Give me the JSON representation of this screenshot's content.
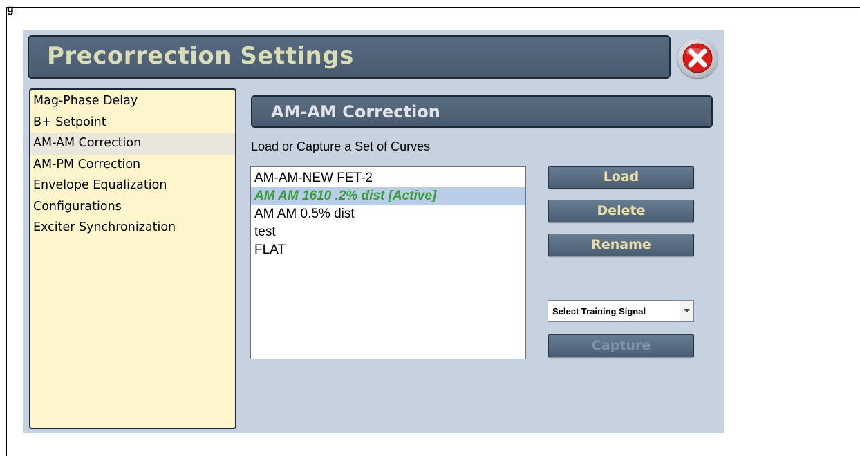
{
  "document": {
    "heading_fragment": "g"
  },
  "title_bar": {
    "title": "Precorrection Settings"
  },
  "close_button": {
    "icon": "close-icon",
    "color": "#e02020"
  },
  "nav": {
    "items": [
      {
        "label": "Mag-Phase Delay"
      },
      {
        "label": "B+ Setpoint"
      },
      {
        "label": "AM-AM Correction"
      },
      {
        "label": "AM-PM Correction"
      },
      {
        "label": "Envelope Equalization"
      },
      {
        "label": "Configurations"
      },
      {
        "label": "Exciter Synchronization"
      }
    ],
    "selected": "AM-AM Correction"
  },
  "section": {
    "title": "AM-AM Correction",
    "instructions": "Load or Capture a Set of Curves"
  },
  "curves": {
    "items": [
      {
        "label": "AM-AM-NEW FET-2"
      },
      {
        "label": "AM AM 1610 .2% dist [Active]"
      },
      {
        "label": "AM AM 0.5% dist"
      },
      {
        "label": "test"
      },
      {
        "label": "FLAT"
      }
    ],
    "active": "AM AM 1610 .2% dist [Active]"
  },
  "actions": {
    "load_label": "Load",
    "delete_label": "Delete",
    "rename_label": "Rename",
    "capture_label": "Capture",
    "capture_enabled": false
  },
  "training_signal": {
    "selected": "Select Training Signal"
  },
  "colors": {
    "accent_text": "#e8dfa8",
    "active_curve_text": "#3a9a3c",
    "panel_background": "#c6d2df",
    "nav_background": "#fef5cc"
  }
}
